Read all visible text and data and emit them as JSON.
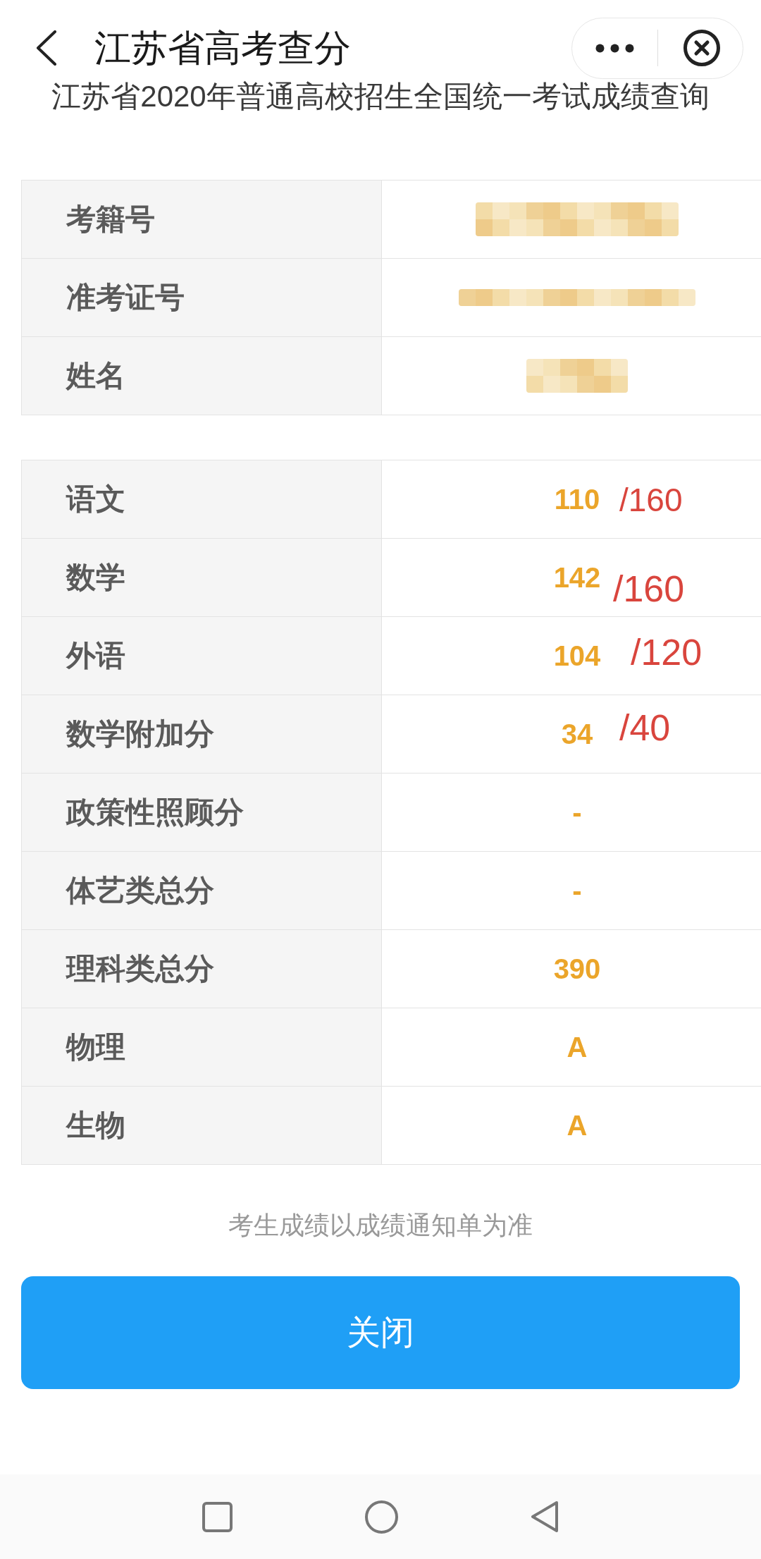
{
  "top_bar": {
    "title": "江苏省高考查分"
  },
  "page_heading": "江苏省2020年普通高校招生全国统一考试成绩查询",
  "identity_table": {
    "rows": [
      {
        "label": "考籍号",
        "redacted": true
      },
      {
        "label": "准考证号",
        "redacted": true
      },
      {
        "label": "姓名",
        "redacted": true
      }
    ]
  },
  "score_table": {
    "rows": [
      {
        "label": "语文",
        "value": "110",
        "annotation": "/160"
      },
      {
        "label": "数学",
        "value": "142",
        "annotation": "/160"
      },
      {
        "label": "外语",
        "value": "104",
        "annotation": "/120"
      },
      {
        "label": "数学附加分",
        "value": "34",
        "annotation": "/40"
      },
      {
        "label": "政策性照顾分",
        "value": "-"
      },
      {
        "label": "体艺类总分",
        "value": "-"
      },
      {
        "label": "理科类总分",
        "value": "390"
      },
      {
        "label": "物理",
        "value": "A"
      },
      {
        "label": "生物",
        "value": "A"
      }
    ]
  },
  "notice": "考生成绩以成绩通知单为准",
  "close_button": {
    "label": "关闭"
  }
}
